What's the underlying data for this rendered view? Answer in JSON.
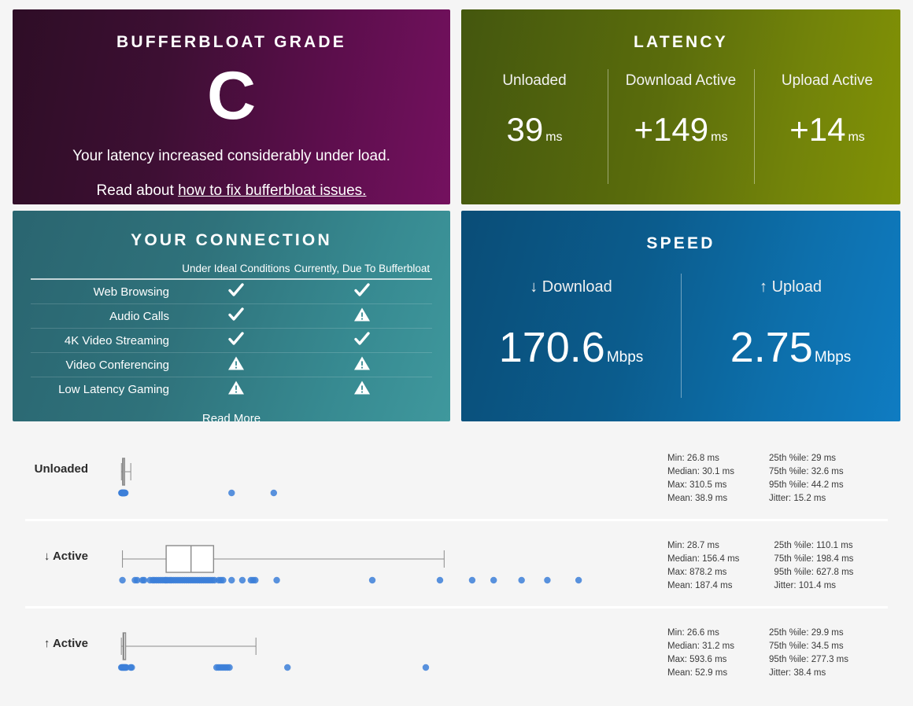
{
  "grade_card": {
    "title": "BUFFERBLOAT GRADE",
    "grade": "C",
    "description": "Your latency increased considerably under load.",
    "read_about_prefix": "Read about ",
    "read_about_link": "how to fix bufferbloat issues.",
    "bg_from": "#2E0D26",
    "bg_to": "#74115F"
  },
  "latency_card": {
    "title": "LATENCY",
    "bg_from": "#44570E",
    "bg_to": "#829205",
    "columns": [
      {
        "label": "Unloaded",
        "value": "39",
        "unit": "ms"
      },
      {
        "label": "Download Active",
        "value": "+149",
        "unit": "ms"
      },
      {
        "label": "Upload Active",
        "value": "+14",
        "unit": "ms"
      }
    ]
  },
  "connection_card": {
    "title": "YOUR CONNECTION",
    "bg_from": "#2A6570",
    "bg_to": "#3F989D",
    "header_rowlabel": "",
    "header_ideal": "Under Ideal Conditions",
    "header_current": "Currently, Due To Bufferbloat",
    "rows": [
      {
        "name": "Web Browsing",
        "ideal": "check",
        "current": "check"
      },
      {
        "name": "Audio Calls",
        "ideal": "check",
        "current": "warning"
      },
      {
        "name": "4K Video Streaming",
        "ideal": "check",
        "current": "check"
      },
      {
        "name": "Video Conferencing",
        "ideal": "warning",
        "current": "warning"
      },
      {
        "name": "Low Latency Gaming",
        "ideal": "warning",
        "current": "warning"
      }
    ],
    "read_more": "Read More"
  },
  "speed_card": {
    "title": "SPEED",
    "bg_from": "#0A4D77",
    "bg_to": "#0F7CC2",
    "columns": [
      {
        "label": "↓ Download",
        "value": "170.6",
        "unit": "Mbps"
      },
      {
        "label": "↑ Upload",
        "value": "2.75",
        "unit": "Mbps"
      }
    ]
  },
  "chart_data": {
    "type": "box",
    "title": "",
    "xlabel": "",
    "ylabel": "",
    "point_color": "#3C7FD8",
    "box_stroke": "#8a8a8a",
    "series": [
      {
        "name": "Unloaded",
        "label": "Unloaded",
        "box": {
          "min": 26.8,
          "q1": 29,
          "median": 30.1,
          "q3": 32.6,
          "whisker_high": 44.2,
          "max": 310.5
        },
        "axis_max": 900,
        "stats_left": [
          "Min: 26.8 ms",
          "Median: 30.1 ms",
          "Max: 310.5 ms",
          "Mean: 38.9 ms"
        ],
        "stats_right": [
          "25th %ile: 29 ms",
          "75th %ile: 32.6 ms",
          "95th %ile: 44.2 ms",
          "Jitter: 15.2 ms"
        ],
        "points": [
          26.8,
          27.2,
          27.6,
          28.1,
          28.4,
          28.8,
          29.1,
          29.4,
          29.8,
          30.1,
          30.4,
          30.9,
          31.3,
          31.8,
          32.2,
          32.6,
          33.1,
          34.0,
          232.0,
          310.5
        ]
      },
      {
        "name": "Download Active",
        "label": "↓ Active",
        "box": {
          "min": 28.7,
          "q1": 110.1,
          "median": 156.4,
          "q3": 198.4,
          "whisker_high": 627.8,
          "max": 878.2
        },
        "axis_max": 900,
        "stats_left": [
          "Min: 28.7 ms",
          "Median: 156.4 ms",
          "Max: 878.2 ms",
          "Mean: 187.4 ms"
        ],
        "stats_right": [
          "25th %ile: 110.1 ms",
          "75th %ile: 198.4 ms",
          "95th %ile: 627.8 ms",
          "Jitter: 101.4 ms"
        ],
        "points": [
          28.7,
          52,
          56,
          66,
          69,
          80,
          85,
          88,
          92,
          96,
          100,
          104,
          108,
          110,
          113,
          117,
          120,
          124,
          128,
          132,
          136,
          140,
          144,
          148,
          152,
          156,
          160,
          164,
          168,
          172,
          176,
          180,
          184,
          188,
          192,
          196,
          200,
          208,
          212,
          216,
          232,
          252,
          268,
          272,
          276,
          316,
          494,
          620,
          680,
          720,
          772,
          820,
          878.2
        ]
      },
      {
        "name": "Upload Active",
        "label": "↑ Active",
        "box": {
          "min": 26.6,
          "q1": 29.9,
          "median": 31.2,
          "q3": 34.5,
          "whisker_high": 277.3,
          "max": 593.6
        },
        "axis_max": 900,
        "stats_left": [
          "Min: 26.6 ms",
          "Median: 31.2 ms",
          "Max: 593.6 ms",
          "Mean: 52.9 ms"
        ],
        "stats_right": [
          "25th %ile: 29.9 ms",
          "75th %ile: 34.5 ms",
          "95th %ile: 277.3 ms",
          "Jitter: 38.4 ms"
        ],
        "points": [
          26.6,
          28.0,
          29.2,
          30.4,
          31.2,
          32.4,
          33.6,
          34.5,
          36.0,
          44.0,
          46.0,
          204,
          208,
          212,
          216,
          220,
          224,
          228,
          336,
          593.6
        ]
      }
    ]
  }
}
